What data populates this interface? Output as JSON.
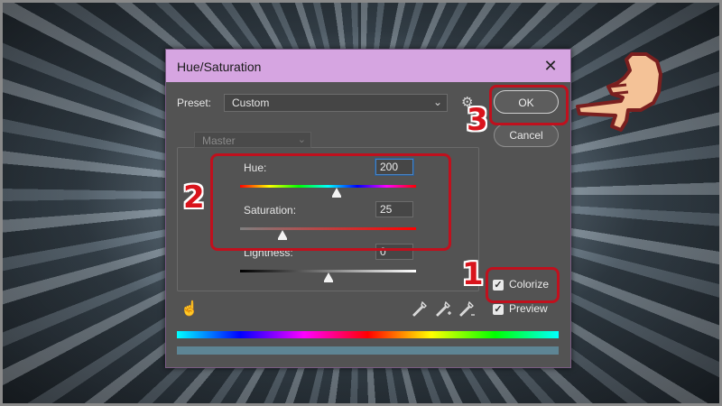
{
  "dialog": {
    "title": "Hue/Saturation",
    "close_glyph": "✕"
  },
  "preset": {
    "label": "Preset:",
    "value": "Custom"
  },
  "channel": {
    "value": "Master"
  },
  "hue": {
    "label": "Hue:",
    "value": "200",
    "slider_fraction": 0.55
  },
  "saturation": {
    "label": "Saturation:",
    "value": "25",
    "slider_fraction": 0.24
  },
  "lightness": {
    "label": "Lightness:",
    "value": "0",
    "slider_fraction": 0.5
  },
  "buttons": {
    "ok": "OK",
    "cancel": "Cancel"
  },
  "checkboxes": {
    "colorize": {
      "label": "Colorize",
      "checked": true
    },
    "preview": {
      "label": "Preview",
      "checked": true
    }
  },
  "annotations": {
    "step1": "1",
    "step2": "2",
    "step3": "3",
    "color": "#c0101d"
  },
  "icons": {
    "close": "close-icon",
    "chevron": "chevron-down-icon",
    "gear": "gear-icon",
    "hand": "targeted-adjustment-hand-icon",
    "eyedropper": "eyedropper-icon",
    "eyedropper_add": "eyedropper-plus-icon",
    "eyedropper_sub": "eyedropper-minus-icon",
    "pointing_hand": "pointing-hand-icon"
  },
  "colors": {
    "titlebar": "#d6a5e1",
    "dialog_bg": "#535353",
    "highlight": "#c0101d"
  }
}
